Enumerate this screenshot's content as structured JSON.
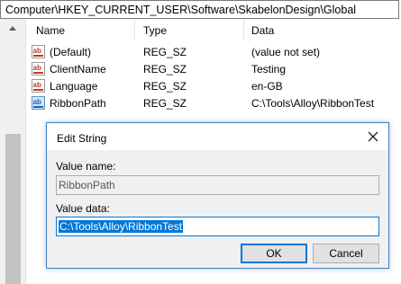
{
  "address_bar": {
    "path": "Computer\\HKEY_CURRENT_USER\\Software\\SkabelonDesign\\Global"
  },
  "columns": {
    "name": "Name",
    "type": "Type",
    "data": "Data"
  },
  "rows": [
    {
      "name": "(Default)",
      "type": "REG_SZ",
      "data": "(value not set)",
      "icon": "ab-string-icon"
    },
    {
      "name": "ClientName",
      "type": "REG_SZ",
      "data": "Testing",
      "icon": "ab-string-icon"
    },
    {
      "name": "Language",
      "type": "REG_SZ",
      "data": "en-GB",
      "icon": "ab-string-icon"
    },
    {
      "name": "RibbonPath",
      "type": "REG_SZ",
      "data": "C:\\Tools\\Alloy\\RibbonTest",
      "icon": "ab-string-icon"
    }
  ],
  "dialog": {
    "title": "Edit String",
    "value_name_label": "Value name:",
    "value_name": "RibbonPath",
    "value_data_label": "Value data:",
    "value_data": "C:\\Tools\\Alloy\\RibbonTest",
    "ok_label": "OK",
    "cancel_label": "Cancel"
  },
  "colors": {
    "accent": "#0078d7",
    "icon_red": "#c0392b",
    "icon_blue": "#1e5fb4"
  }
}
